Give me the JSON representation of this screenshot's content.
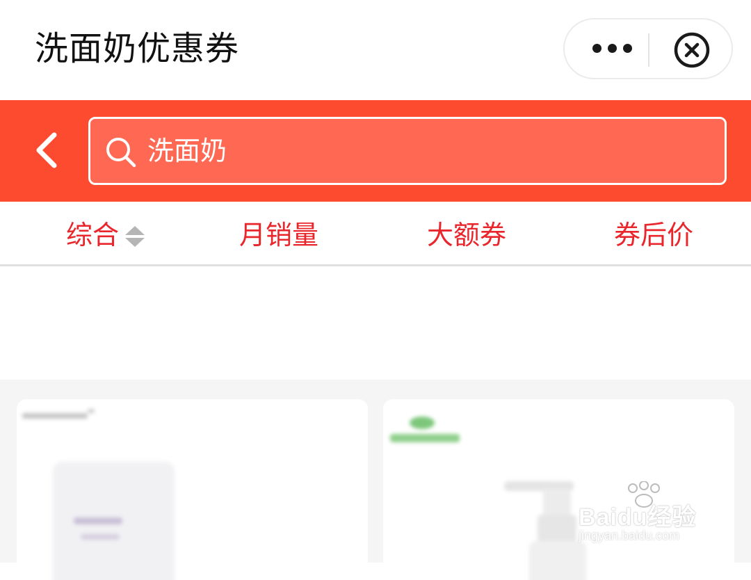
{
  "titlebar": {
    "title": "洗面奶优惠券"
  },
  "search": {
    "value": "洗面奶"
  },
  "tabs": [
    {
      "label": "综合"
    },
    {
      "label": "月销量"
    },
    {
      "label": "大额券"
    },
    {
      "label": "券后价"
    }
  ],
  "colors": {
    "accent": "#fd4b30",
    "tab_text": "#e8262c"
  },
  "watermark": {
    "brand": "Baidu经验",
    "url": "jingyan.baidu.com"
  }
}
